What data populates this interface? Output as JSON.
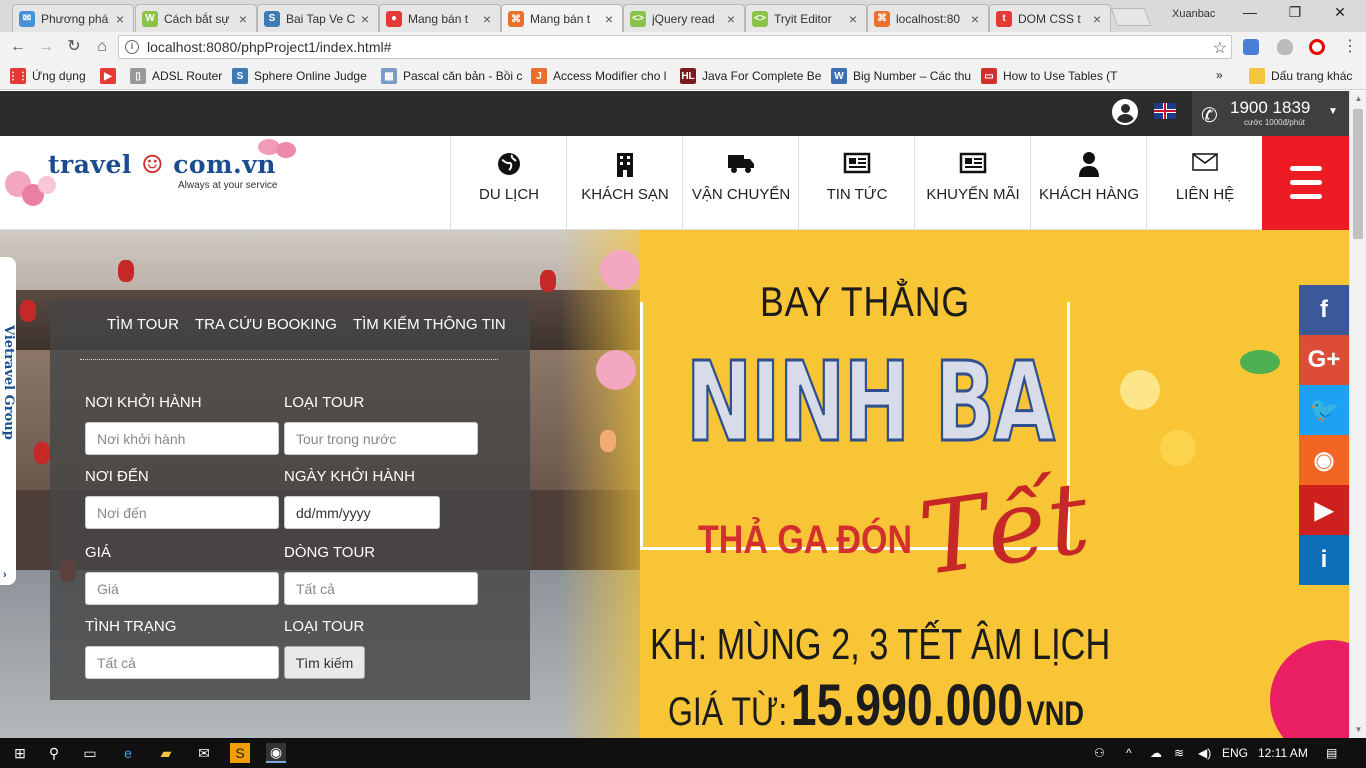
{
  "browser": {
    "tabs": [
      {
        "title": "Phương phá",
        "color": "#4a90d9",
        "glyph": "✉"
      },
      {
        "title": "Cách bắt sự",
        "color": "#8bc34a",
        "glyph": "W"
      },
      {
        "title": "Bai Tap Ve C",
        "color": "#3d7bb5",
        "glyph": "S"
      },
      {
        "title": "Mang bán t",
        "color": "#e53935",
        "glyph": "●"
      },
      {
        "title": "Mang bán t",
        "color": "#e8702a",
        "glyph": "⌘"
      },
      {
        "title": "jQuery read",
        "color": "#8bc34a",
        "glyph": "<>"
      },
      {
        "title": "Tryit Editor",
        "color": "#8bc34a",
        "glyph": "<>"
      },
      {
        "title": "localhost:80",
        "color": "#e8702a",
        "glyph": "⌘"
      },
      {
        "title": "DOM CSS t",
        "color": "#e53935",
        "glyph": "t"
      }
    ],
    "active_tab": 4,
    "profile_name": "Xuanbac",
    "url": "localhost:8080/phpProject1/index.html#",
    "bookmarks": [
      {
        "label": "Ứng dụng",
        "color": "#e53935",
        "glyph": "⋮⋮"
      },
      {
        "label": "",
        "color": "#e53935",
        "glyph": "▶"
      },
      {
        "label": "ADSL Router",
        "color": "#999999",
        "glyph": "▯"
      },
      {
        "label": "Sphere Online Judge",
        "color": "#3d7bb5",
        "glyph": "S"
      },
      {
        "label": "Pascal căn bản - Bồi c",
        "color": "#7a9cc6",
        "glyph": "▦"
      },
      {
        "label": "Access Modifier cho l",
        "color": "#e8702a",
        "glyph": "J"
      },
      {
        "label": "Java For Complete Be",
        "color": "#7b1a1a",
        "glyph": "HL"
      },
      {
        "label": "Big Number – Các thu",
        "color": "#3d6fb5",
        "glyph": "W"
      },
      {
        "label": "How to Use Tables (T",
        "color": "#d32f2f",
        "glyph": "▭"
      }
    ],
    "more_bookmarks": "»",
    "bookmarks_folder": "Dấu trang khác"
  },
  "site": {
    "hotline_number": "1900 1839",
    "hotline_sub": "cước 1000đ/phút",
    "logo_part1": "travel",
    "logo_part2": "com.vn",
    "logo_tagline": "Always at your service",
    "nav": [
      {
        "label": "DU LỊCH",
        "icon": "globe-icon"
      },
      {
        "label": "KHÁCH SẠN",
        "icon": "building-icon"
      },
      {
        "label": "VẬN CHUYỂN",
        "icon": "truck-icon"
      },
      {
        "label": "TIN TỨC",
        "icon": "newspaper-icon"
      },
      {
        "label": "KHUYẾN MÃI",
        "icon": "newspaper-icon"
      },
      {
        "label": "KHÁCH HÀNG",
        "icon": "user-icon"
      },
      {
        "label": "LIÊN HỆ",
        "icon": "envelope-icon"
      }
    ],
    "side_tab": "Vietravel Group",
    "side_tab_arrow": "›",
    "search": {
      "tabs": [
        "TÌM TOUR",
        "TRA CỨU BOOKING",
        "TÌM KIẾM THÔNG TIN"
      ],
      "labels": {
        "departure": "NƠI KHỞI HÀNH",
        "tour_type": "LOẠI TOUR",
        "destination": "NƠI ĐẾN",
        "depart_date": "NGÀY KHỞI HÀNH",
        "price": "GIÁ",
        "tour_line": "DÒNG TOUR",
        "status": "TÌNH TRẠNG",
        "tour_type2": "LOẠI TOUR"
      },
      "placeholders": {
        "departure": "Nơi khởi hành",
        "tour_type": "Tour trong nước",
        "destination": "Nơi đến",
        "depart_date": "dd/mm/yyyy",
        "price": "Giá",
        "tour_line": "Tất cả",
        "status": "Tất cả"
      },
      "button": "Tìm kiếm"
    },
    "promo": {
      "line1": "BAY THẲNG",
      "line2": "NINH BA",
      "line3": "THẢ GA ĐÓN",
      "line3b": "Tết",
      "line4": "KH: MÙNG 2, 3 TẾT ÂM LỊCH",
      "price_prefix": "GIÁ TỪ:",
      "price_value": "15.990.000",
      "price_unit": "VND"
    },
    "social": [
      {
        "name": "facebook",
        "glyph": "f",
        "color": "#3b5998"
      },
      {
        "name": "google-plus",
        "glyph": "G+",
        "color": "#dd4b39"
      },
      {
        "name": "twitter",
        "glyph": "🐦",
        "color": "#1da1f2"
      },
      {
        "name": "rss",
        "glyph": "◉",
        "color": "#f26522"
      },
      {
        "name": "youtube",
        "glyph": "▶",
        "color": "#cd201f"
      },
      {
        "name": "info",
        "glyph": "i",
        "color": "#0e6eb8"
      }
    ]
  },
  "taskbar": {
    "language": "ENG",
    "time": "12:11 AM"
  }
}
